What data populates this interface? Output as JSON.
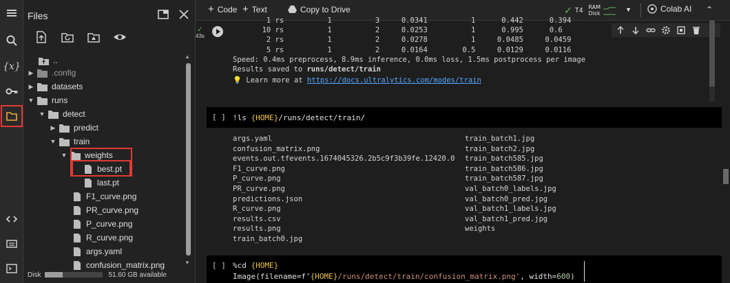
{
  "files_panel": {
    "title": "Files",
    "tree": [
      {
        "label": "..",
        "kind": "up"
      },
      {
        "label": ".config",
        "kind": "folder",
        "dim": true
      },
      {
        "label": "datasets",
        "kind": "folder"
      },
      {
        "label": "runs",
        "kind": "folder",
        "open": true
      },
      {
        "label": "detect",
        "kind": "folder",
        "open": true
      },
      {
        "label": "predict",
        "kind": "folder"
      },
      {
        "label": "train",
        "kind": "folder",
        "open": true
      },
      {
        "label": "weights",
        "kind": "folder",
        "open": true
      },
      {
        "label": "best.pt",
        "kind": "file"
      },
      {
        "label": "last.pt",
        "kind": "file"
      },
      {
        "label": "F1_curve.png",
        "kind": "file"
      },
      {
        "label": "PR_curve.png",
        "kind": "file"
      },
      {
        "label": "P_curve.png",
        "kind": "file"
      },
      {
        "label": "R_curve.png",
        "kind": "file"
      },
      {
        "label": "args.yaml",
        "kind": "file"
      },
      {
        "label": "confusion_matrix.png",
        "kind": "file"
      }
    ],
    "disk_label": "Disk",
    "disk_available": "51.60 GB available",
    "disk_used_fraction": 0.3
  },
  "toolbar": {
    "code_label": "Code",
    "text_label": "Text",
    "drive_label": "Copy to Drive",
    "runtime": "T4",
    "ram_label": "RAM",
    "disk_label": "Disk",
    "colab_ai_label": "Colab AI"
  },
  "output": {
    "rows": [
      "         1 rs          1          3     0.0341          1      0.442      0.394",
      "        10 rs          1          2     0.0253          1      0.995      0.6",
      "         2 rs          1          2     0.0278          1     0.0485     0.0459",
      "         5 rs          1          2     0.0164        0.5     0.0129     0.0116"
    ],
    "speed_line": "Speed: 0.4ms preprocess, 8.9ms inference, 0.0ms loss, 1.5ms postprocess per image",
    "saved_prefix": "Results saved to ",
    "saved_path": "runs/detect/train",
    "learn_prefix": "Learn more at ",
    "learn_link": "https://docs.ultralytics.com/modes/train",
    "exec_time": "43s"
  },
  "cell_ls": {
    "bracket": "[ ]",
    "code_prefix": "!ls ",
    "code_var": "{HOME}",
    "code_suffix": "/runs/detect/train/",
    "files_col1": [
      "args.yaml",
      "confusion_matrix.png",
      "events.out.tfevents.1674045326.2b5c9f3b39fe.12420.0",
      "F1_curve.png",
      "P_curve.png",
      "PR_curve.png",
      "predictions.json",
      "R_curve.png",
      "results.csv",
      "results.png",
      "train_batch0.jpg"
    ],
    "files_col2": [
      "train_batch1.jpg",
      "train_batch2.jpg",
      "train_batch585.jpg",
      "train_batch586.jpg",
      "train_batch587.jpg",
      "val_batch0_labels.jpg",
      "val_batch0_pred.jpg",
      "val_batch1_labels.jpg",
      "val_batch1_pred.jpg",
      "weights"
    ]
  },
  "cell_cd": {
    "bracket": "[ ]",
    "line1_prefix": "%cd ",
    "line1_var": "{HOME}",
    "line2_prefix": "Image(filename=f'",
    "line2_var": "{HOME}",
    "line2_str": "/runs/detect/train/confusion_matrix.png'",
    "line2_mid": ", width=",
    "line2_num": "600",
    "line2_end": ")"
  }
}
